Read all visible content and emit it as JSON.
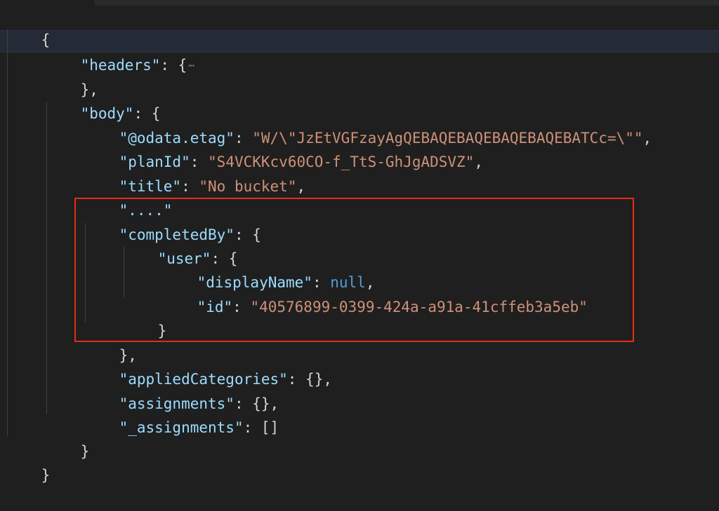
{
  "editor": {
    "lines": [
      {
        "text": "{"
      },
      {
        "key": "\"headers\"",
        "sep": ": {",
        "folded": true
      },
      {
        "text": "},"
      },
      {
        "key": "\"body\"",
        "sep": ": {"
      },
      {
        "key": "\"@odata.etag\"",
        "sep": ": ",
        "value": "\"W/\\\"JzEtVGFzayAgQEBAQEBAQEBAQEBAQEBATCc=\\\"\"",
        "end": ","
      },
      {
        "key": "\"planId\"",
        "sep": ": ",
        "value": "\"S4VCKKcv60CO-f_TtS-GhJgADSVZ\"",
        "end": ","
      },
      {
        "key": "\"title\"",
        "sep": ": ",
        "value": "\"No bucket\"",
        "end": ","
      },
      {
        "key": "\"....\""
      },
      {
        "key": "\"completedBy\"",
        "sep": ": {"
      },
      {
        "key": "\"user\"",
        "sep": ": {"
      },
      {
        "key": "\"displayName\"",
        "sep": ": ",
        "value": "null",
        "end": ","
      },
      {
        "key": "\"id\"",
        "sep": ": ",
        "value": "\"40576899-0399-424a-a91a-41cffeb3a5eb\""
      },
      {
        "text": "}"
      },
      {
        "text": "},"
      },
      {
        "key": "\"appliedCategories\"",
        "sep": ": {},"
      },
      {
        "key": "\"assignments\"",
        "sep": ": {},"
      },
      {
        "key": "\"_assignments\"",
        "sep": ": []"
      },
      {
        "text": "}"
      },
      {
        "text": "}"
      }
    ],
    "fold_placeholder": "⋯"
  },
  "colors": {
    "background": "#1f1f1f",
    "key": "#9cdcfe",
    "string": "#ce9178",
    "keyword": "#569cd6",
    "punctuation": "#d4d4d4",
    "annotation_box": "#e52d16"
  }
}
